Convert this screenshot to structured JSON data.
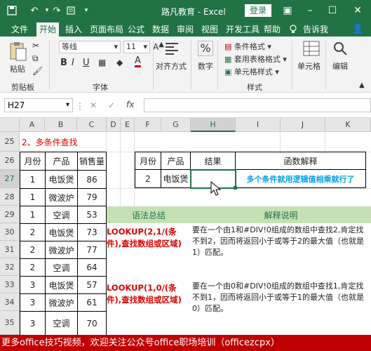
{
  "title_bar": {
    "title": "路凡教育 - Excel",
    "login": "登录"
  },
  "tabs": [
    "文件",
    "开始",
    "插入",
    "页面布局",
    "公式",
    "数据",
    "审阅",
    "视图",
    "开发工具",
    "帮助",
    "告诉我"
  ],
  "ribbon": {
    "paste": "粘贴",
    "clipboard": "剪贴板",
    "font_name": "等线",
    "font_size": "11",
    "font_group": "字体",
    "align": "对齐方式",
    "number": "数字",
    "percent": "%",
    "cond_format": "条件格式",
    "table_format": "套用表格格式",
    "cell_style": "单元格样式",
    "style_group": "样式",
    "cells": "单元格",
    "edit": "编辑",
    "bold": "B",
    "italic": "I",
    "underline": "U",
    "font_a": "A"
  },
  "formula_bar": {
    "name_box": "H27",
    "fx": "fx",
    "cancel": "✕",
    "enter": "✓"
  },
  "columns": [
    "A",
    "B",
    "C",
    "D",
    "E",
    "F",
    "G",
    "H",
    "I",
    "J",
    "K"
  ],
  "rows": [
    "25",
    "26",
    "27",
    "28",
    "29",
    "30",
    "31",
    "32",
    "33",
    "34",
    "35"
  ],
  "sheet": {
    "section_title": "2、多条件查找",
    "left_table": {
      "headers": [
        "月份",
        "产品",
        "销售量"
      ],
      "rows": [
        [
          "1",
          "电饭煲",
          "86"
        ],
        [
          "1",
          "微波炉",
          "79"
        ],
        [
          "1",
          "空调",
          "53"
        ],
        [
          "2",
          "电饭煲",
          "73"
        ],
        [
          "2",
          "微波炉",
          "77"
        ],
        [
          "2",
          "空调",
          "64"
        ],
        [
          "3",
          "电饭煲",
          "57"
        ],
        [
          "3",
          "微波炉",
          "61"
        ],
        [
          "3",
          "空调",
          "70"
        ]
      ]
    },
    "lookup_table": {
      "headers": [
        "月份",
        "产品",
        "结果",
        "函数解释"
      ],
      "row": [
        "2",
        "电饭煲",
        "",
        "多个条件就用逻辑值相乘就行了"
      ]
    },
    "syntax_header": "语法总结",
    "explain_header": "解释说明",
    "syntax1": "LOOKUP(2,1/(条件),查找数组或区域)",
    "explain1": "要在一个由1和#DIV!0组成的数组中查找2,肯定找不到2，因而将返回小于或等于2的最大值（也就是1）匹配。",
    "syntax2": "LOOKUP(1,0/(条件),查找数组或区域)",
    "explain2": "要在一个由0和#DIV!0组成的数组中查找1,肯定找不到1，因而将返回小于或等于1的最大值（也就是0）匹配。"
  },
  "banner": "更多office技巧视频，欢迎关注公众号office职场培训（officezcpx）",
  "colors": {
    "excel_green": "#217346",
    "header_green": "#c6e0b4",
    "red_text": "#e00000",
    "blue_text": "#00a0e8",
    "banner_red": "#c00000"
  }
}
